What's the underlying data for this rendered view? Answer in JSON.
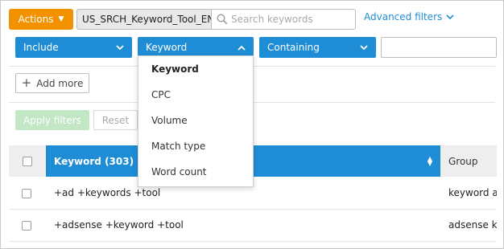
{
  "toolbar": {
    "actions_label": "Actions",
    "keyword_list": "US_SRCH_Keyword_Tool_EN",
    "search_placeholder": "Search keywords",
    "advanced_filters_label": "Advanced filters"
  },
  "filter_row": {
    "include_label": "Include",
    "field_label": "Keyword",
    "condition_label": "Containing",
    "value": ""
  },
  "dropdown": {
    "options": [
      "Keyword",
      "CPC",
      "Volume",
      "Match type",
      "Word count"
    ],
    "selected": "Keyword"
  },
  "buttons": {
    "add_more_label": "Add more",
    "apply_label": "Apply filters",
    "reset_label": "Reset"
  },
  "table": {
    "keyword_header": "Keyword  (303)",
    "group_header": "Group",
    "rows": [
      {
        "keyword": "+ad +keywords +tool",
        "group": "keyword ad"
      },
      {
        "keyword": "+adsense +keyword +tool",
        "group": "adsense ke"
      }
    ]
  },
  "colors": {
    "accent_orange": "#f39200",
    "primary_blue": "#1f8dd6",
    "apply_disabled_green": "#c1e7c4"
  },
  "icons": {
    "actions": "chevron-down-icon",
    "search": "search-icon",
    "advanced": "chevron-down-icon",
    "field_select": "chevron-up-icon",
    "add_more": "plus-icon",
    "sort": "sort-icon"
  }
}
